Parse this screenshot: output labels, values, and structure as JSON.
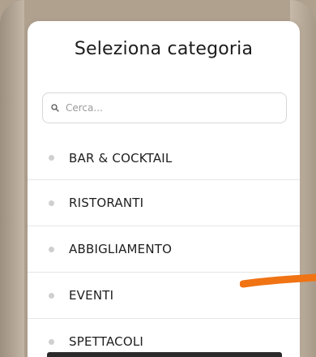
{
  "modal": {
    "title": "Seleziona categoria"
  },
  "search": {
    "placeholder": "Cerca...",
    "icon": "search-icon"
  },
  "categories": [
    {
      "label": "BAR & COCKTAIL"
    },
    {
      "label": "RISTORANTI"
    },
    {
      "label": "ABBIGLIAMENTO"
    },
    {
      "label": "EVENTI"
    },
    {
      "label": "SPETTACOLI"
    }
  ],
  "colors": {
    "background": "#b0a18f",
    "modal": "#ffffff",
    "bullet": "#cfcfcf",
    "accent_stroke": "#f07314"
  }
}
